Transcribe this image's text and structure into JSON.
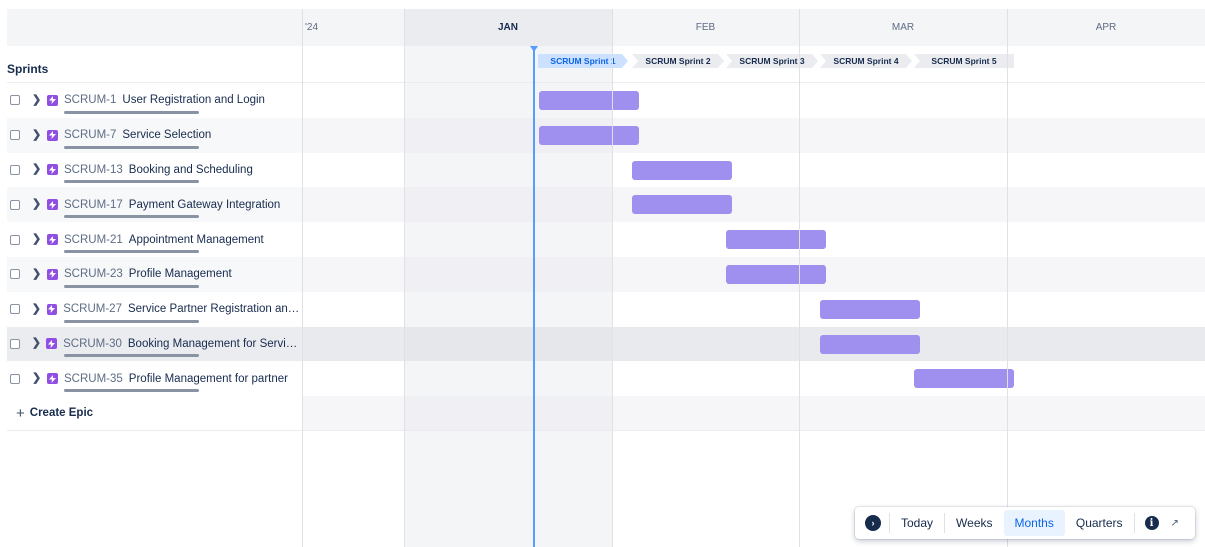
{
  "timeline": {
    "year_label": "'24",
    "months": [
      "JAN",
      "FEB",
      "MAR",
      "APR"
    ],
    "current_month": "JAN"
  },
  "sprints": {
    "label": "Sprints",
    "items": [
      {
        "name": "SCRUM Sprint 1",
        "active": true
      },
      {
        "name": "SCRUM Sprint 2",
        "active": false
      },
      {
        "name": "SCRUM Sprint 3",
        "active": false
      },
      {
        "name": "SCRUM Sprint 4",
        "active": false
      },
      {
        "name": "SCRUM Sprint 5",
        "active": false
      }
    ]
  },
  "epics": [
    {
      "key": "SCRUM-1",
      "name": "User Registration and Login",
      "sprint": 1
    },
    {
      "key": "SCRUM-7",
      "name": "Service Selection",
      "sprint": 1
    },
    {
      "key": "SCRUM-13",
      "name": "Booking and Scheduling",
      "sprint": 2
    },
    {
      "key": "SCRUM-17",
      "name": "Payment Gateway Integration",
      "sprint": 2
    },
    {
      "key": "SCRUM-21",
      "name": "Appointment Management",
      "sprint": 3
    },
    {
      "key": "SCRUM-23",
      "name": "Profile Management",
      "sprint": 3
    },
    {
      "key": "SCRUM-27",
      "name": "Service Partner Registration and ...",
      "sprint": 4
    },
    {
      "key": "SCRUM-30",
      "name": "Booking Management for Service...",
      "sprint": 4
    },
    {
      "key": "SCRUM-35",
      "name": "Profile Management for partner",
      "sprint": 5
    }
  ],
  "create_epic_label": "Create Epic",
  "zoom": {
    "today": "Today",
    "weeks": "Weeks",
    "months": "Months",
    "quarters": "Quarters",
    "selected": "Months"
  },
  "colors": {
    "epic_bar": "#9f8fef",
    "epic_icon": "#904ee2",
    "today_line": "#579dff",
    "active_sprint": "#cce0ff"
  }
}
